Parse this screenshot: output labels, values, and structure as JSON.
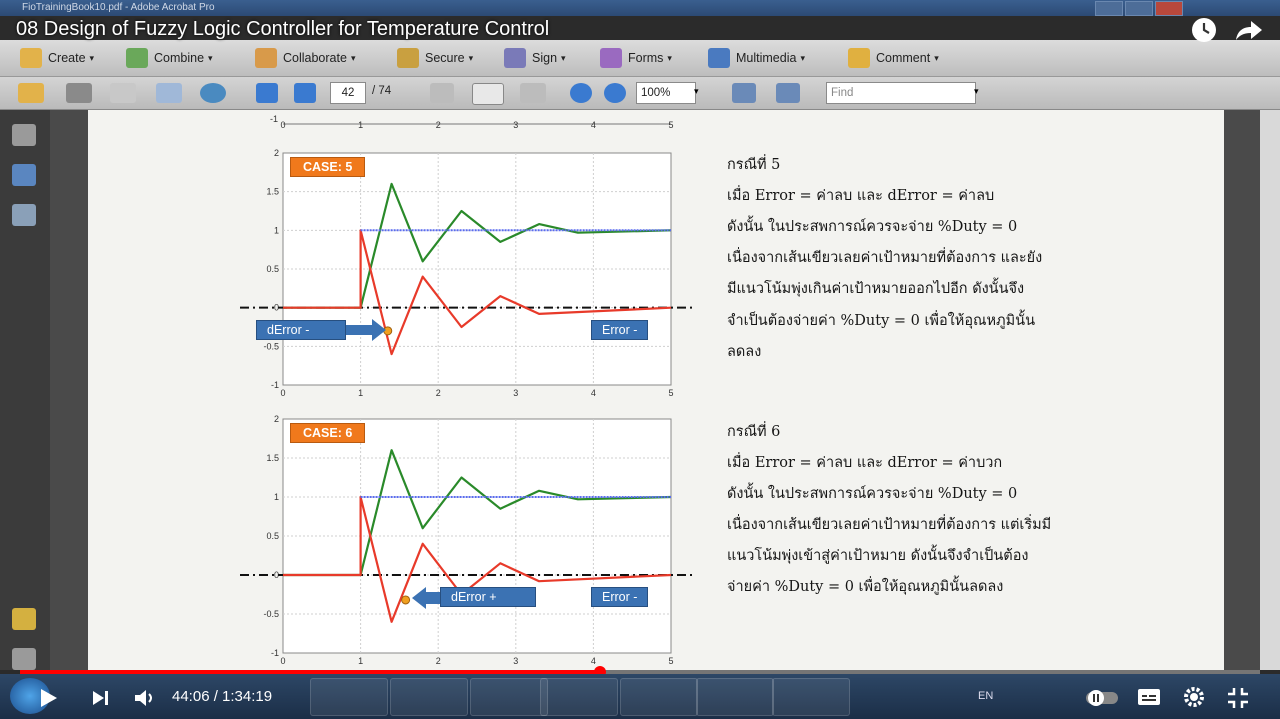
{
  "window": {
    "title": "FioTrainingBook10.pdf - Adobe Acrobat Pro"
  },
  "video": {
    "title": "08 Design of Fuzzy Logic Controller for Temperature Control",
    "current_time": "44:06",
    "duration": "1:34:19",
    "time_display": "44:06 / 1:34:19",
    "progress": 0.468
  },
  "toolbar1": {
    "items": [
      {
        "label": "Create",
        "icon": "create-icon"
      },
      {
        "label": "Combine",
        "icon": "combine-icon"
      },
      {
        "label": "Collaborate",
        "icon": "collaborate-icon"
      },
      {
        "label": "Secure",
        "icon": "lock-icon"
      },
      {
        "label": "Sign",
        "icon": "pen-icon"
      },
      {
        "label": "Forms",
        "icon": "forms-icon"
      },
      {
        "label": "Multimedia",
        "icon": "multimedia-icon"
      },
      {
        "label": "Comment",
        "icon": "comment-icon"
      }
    ]
  },
  "toolbar2": {
    "page_current": "42",
    "page_total": "/ 74",
    "zoom": "100%",
    "find_placeholder": "Find"
  },
  "charts": {
    "case5_label": "CASE: 5",
    "case6_label": "CASE: 6",
    "case5_callout_derror": "dError -",
    "case5_callout_error": "Error -",
    "case6_callout_derror": "dError +",
    "case6_callout_error": "Error -",
    "ytick_labels": [
      "2",
      "1.5",
      "1",
      "0.5",
      "0",
      "-0.5",
      "-1"
    ],
    "xtick_labels": [
      "0",
      "1",
      "2",
      "3",
      "4",
      "5"
    ],
    "top_xtick_labels": [
      "0",
      "1",
      "2",
      "3",
      "4",
      "5"
    ],
    "top_ytick": "-1"
  },
  "chart_data": [
    {
      "type": "line",
      "title": "CASE: 5",
      "xlim": [
        0,
        5
      ],
      "ylim": [
        -1,
        2
      ],
      "grid": true,
      "series": [
        {
          "color": "#2a8a2a",
          "x": [
            0,
            1,
            1.4,
            1.8,
            2.3,
            2.8,
            3.3,
            3.8,
            5
          ],
          "y": [
            0,
            0,
            1.6,
            0.6,
            1.25,
            0.85,
            1.08,
            0.97,
            1
          ]
        },
        {
          "color": "#e83a2a",
          "x": [
            0,
            1,
            1.0,
            1.4,
            1.8,
            2.3,
            2.8,
            3.3,
            5
          ],
          "y": [
            0,
            0,
            1.0,
            -0.6,
            0.4,
            -0.25,
            0.15,
            -0.08,
            0
          ]
        },
        {
          "color": "#5a6cf0",
          "x": [
            1,
            5
          ],
          "y": [
            1,
            1
          ]
        }
      ]
    },
    {
      "type": "line",
      "title": "CASE: 6",
      "xlim": [
        0,
        5
      ],
      "ylim": [
        -1,
        2
      ],
      "grid": true,
      "series": [
        {
          "color": "#2a8a2a",
          "x": [
            0,
            1,
            1.4,
            1.8,
            2.3,
            2.8,
            3.3,
            3.8,
            5
          ],
          "y": [
            0,
            0,
            1.6,
            0.6,
            1.25,
            0.85,
            1.08,
            0.97,
            1
          ]
        },
        {
          "color": "#e83a2a",
          "x": [
            0,
            1,
            1.0,
            1.4,
            1.8,
            2.3,
            2.8,
            3.3,
            5
          ],
          "y": [
            0,
            0,
            1.0,
            -0.6,
            0.4,
            -0.25,
            0.15,
            -0.08,
            0
          ]
        },
        {
          "color": "#5a6cf0",
          "x": [
            1,
            5
          ],
          "y": [
            1,
            1
          ]
        }
      ]
    }
  ],
  "text": {
    "case5": [
      "กรณีที่ 5",
      "เมื่อ Error = ค่าลบ และ dError = ค่าลบ",
      "ดังนั้น  ในประสพการณ์ควรจะจ่าย  %Duty  =  0",
      "เนื่องจากเส้นเขียวเลยค่าเป้าหมายที่ต้องการ  และยัง",
      "มีแนวโน้มพุ่งเกินค่าเป้าหมายออกไปอีก   ดังนั้นจึง",
      "จำเป็นต้องจ่ายค่า %Duty = 0 เพื่อให้อุณหภูมินั้น",
      "ลดลง"
    ],
    "case6": [
      "กรณีที่ 6",
      "เมื่อ Error = ค่าลบ และ dError = ค่าบวก",
      "ดังนั้น  ในประสพการณ์ควรจะจ่าย  %Duty  =  0",
      "เนื่องจากเส้นเขียวเลยค่าเป้าหมายที่ต้องการ แต่เริ่มมี",
      "แนวโน้มพุ่งเข้าสู่ค่าเป้าหมาย    ดังนั้นจึงจำเป็นต้อง",
      "จ่ายค่า %Duty = 0 เพื่อให้อุณหภูมินั้นลดลง"
    ]
  },
  "system_tray": {
    "lang": "EN"
  },
  "colors": {
    "green": "#2a8a2a",
    "red": "#e83a2a",
    "blue": "#5a6cf0",
    "case_label": "#f0791c",
    "callout": "#3b72b3",
    "progress": "#ff0000"
  }
}
